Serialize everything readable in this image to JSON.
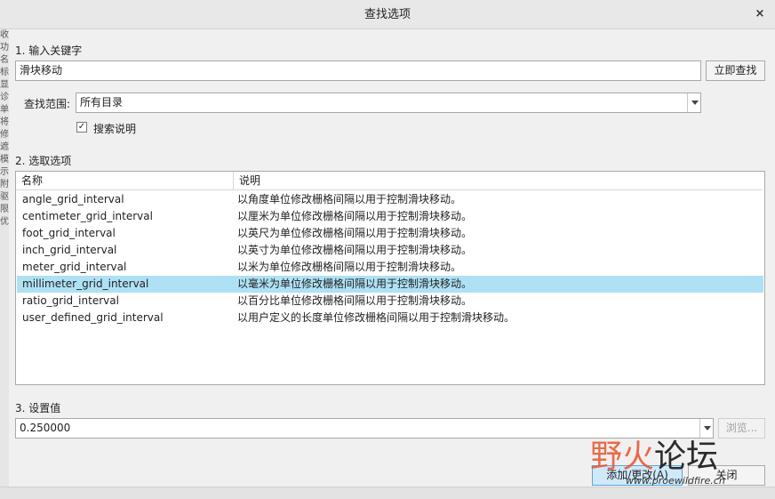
{
  "dialog": {
    "title": "查找选项",
    "close_glyph": "×"
  },
  "section1": {
    "label": "1. 输入关键字",
    "keyword_value": "滑块移动",
    "search_now_label": "立即查找",
    "scope_label": "查找范围:",
    "scope_value": "所有目录",
    "search_desc_checked": true,
    "search_desc_mark": "✓",
    "search_desc_label": "搜索说明"
  },
  "section2": {
    "label": "2. 选取选项",
    "columns": {
      "name": "名称",
      "desc": "说明"
    },
    "rows": [
      {
        "name": "angle_grid_interval",
        "desc": "以角度单位修改栅格间隔以用于控制滑块移动。"
      },
      {
        "name": "centimeter_grid_interval",
        "desc": "以厘米为单位修改栅格间隔以用于控制滑块移动。"
      },
      {
        "name": "foot_grid_interval",
        "desc": "以英尺为单位修改栅格间隔以用于控制滑块移动。"
      },
      {
        "name": "inch_grid_interval",
        "desc": "以英寸为单位修改栅格间隔以用于控制滑块移动。"
      },
      {
        "name": "meter_grid_interval",
        "desc": "以米为单位修改栅格间隔以用于控制滑块移动。"
      },
      {
        "name": "millimeter_grid_interval",
        "desc": "以毫米为单位修改栅格间隔以用于控制滑块移动。",
        "selected": true
      },
      {
        "name": "ratio_grid_interval",
        "desc": "以百分比单位修改栅格间隔以用于控制滑块移动。"
      },
      {
        "name": "user_defined_grid_interval",
        "desc": "以用户定义的长度单位修改栅格间隔以用于控制滑块移动。"
      }
    ]
  },
  "section3": {
    "label": "3. 设置值",
    "value": "0.250000",
    "browse_label": "浏览..."
  },
  "footer": {
    "add_change_label": "添加/更改(A)",
    "close_label": "关闭"
  },
  "watermark": {
    "part1": "野火",
    "part2": "论坛",
    "url": "www.proewildfire.cn"
  },
  "background_left_chars": [
    "收",
    "功",
    "名",
    "标",
    "显",
    "诊",
    "单",
    "将",
    "修",
    "遮",
    "模",
    "示",
    "附",
    "驱",
    "限",
    "优"
  ],
  "colors": {
    "selection": "#aee1f4",
    "primary_button": "#cfe9fb",
    "watermark_red": "#e8542c"
  }
}
